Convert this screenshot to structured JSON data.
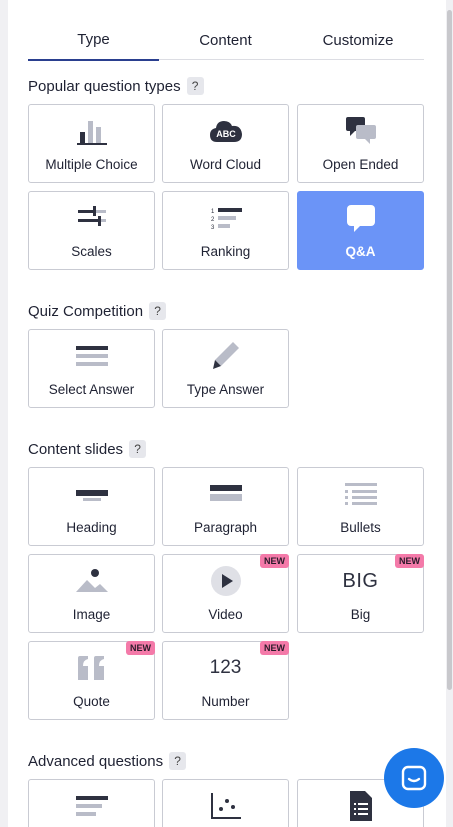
{
  "tabs": [
    "Type",
    "Content",
    "Customize"
  ],
  "help_mark": "?",
  "sections": {
    "popular": "Popular question types",
    "quiz": "Quiz Competition",
    "content": "Content slides",
    "advanced": "Advanced questions"
  },
  "popular_cards": [
    "Multiple Choice",
    "Word Cloud",
    "Open Ended",
    "Scales",
    "Ranking",
    "Q&A"
  ],
  "quiz_cards": [
    "Select Answer",
    "Type Answer"
  ],
  "content_cards": [
    "Heading",
    "Paragraph",
    "Bullets",
    "Image",
    "Video",
    "Big",
    "Quote",
    "Number"
  ],
  "icon_text": {
    "word_cloud": "ABC",
    "big": "BIG",
    "number": "123"
  },
  "badge": "NEW",
  "colors": {
    "accent": "#6b94f7",
    "tab_underline": "#2a3f8f",
    "badge": "#f47aa9",
    "chat": "#1c78e8"
  }
}
